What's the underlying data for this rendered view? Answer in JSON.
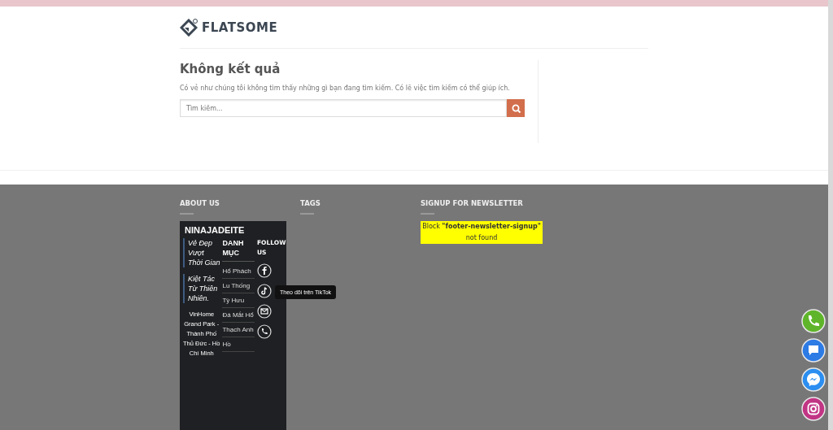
{
  "header": {
    "logo": "FLATSOME"
  },
  "results": {
    "title": "Không kết quả",
    "message": "Có vẻ như chúng tôi không tìm thấy những gì bạn đang tìm kiếm. Có lẽ việc tìm kiếm có thể giúp ích.",
    "search": {
      "placeholder": "Tìm kiếm..."
    }
  },
  "footer": {
    "about_us": {
      "heading": "ABOUT US",
      "widget": {
        "brand": "NINAJADEITE",
        "quotes": [
          "Vẻ Đẹp Vượt Thời Gian",
          "Kiệt Tác Từ Thiên Nhiên."
        ],
        "address": "VinHome Grand Park - Thành Phố Thủ Đức - Hồ Chí Minh",
        "categories": {
          "heading": "DANH MỤC",
          "items": [
            "Hổ Phách",
            "Lu Thống",
            "Tỳ Hưu",
            "Đá Mắt Hổ",
            "Thạch Anh",
            "Hồ"
          ]
        },
        "follow": {
          "heading": "FOLLOW US",
          "icons": [
            {
              "kind": "facebook"
            },
            {
              "kind": "tiktok",
              "tooltip": "Theo dõi trên TikTok"
            },
            {
              "kind": "email"
            },
            {
              "kind": "phone"
            }
          ]
        }
      }
    },
    "tags": {
      "heading": "TAGS"
    },
    "newsletter": {
      "heading": "SIGNUP FOR NEWSLETTER",
      "notice": "Block **\"footer-newsletter-signup\"** not found"
    }
  },
  "floating_buttons": [
    {
      "kind": "phone"
    },
    {
      "kind": "zalo"
    },
    {
      "kind": "messenger"
    },
    {
      "kind": "instagram"
    }
  ]
}
